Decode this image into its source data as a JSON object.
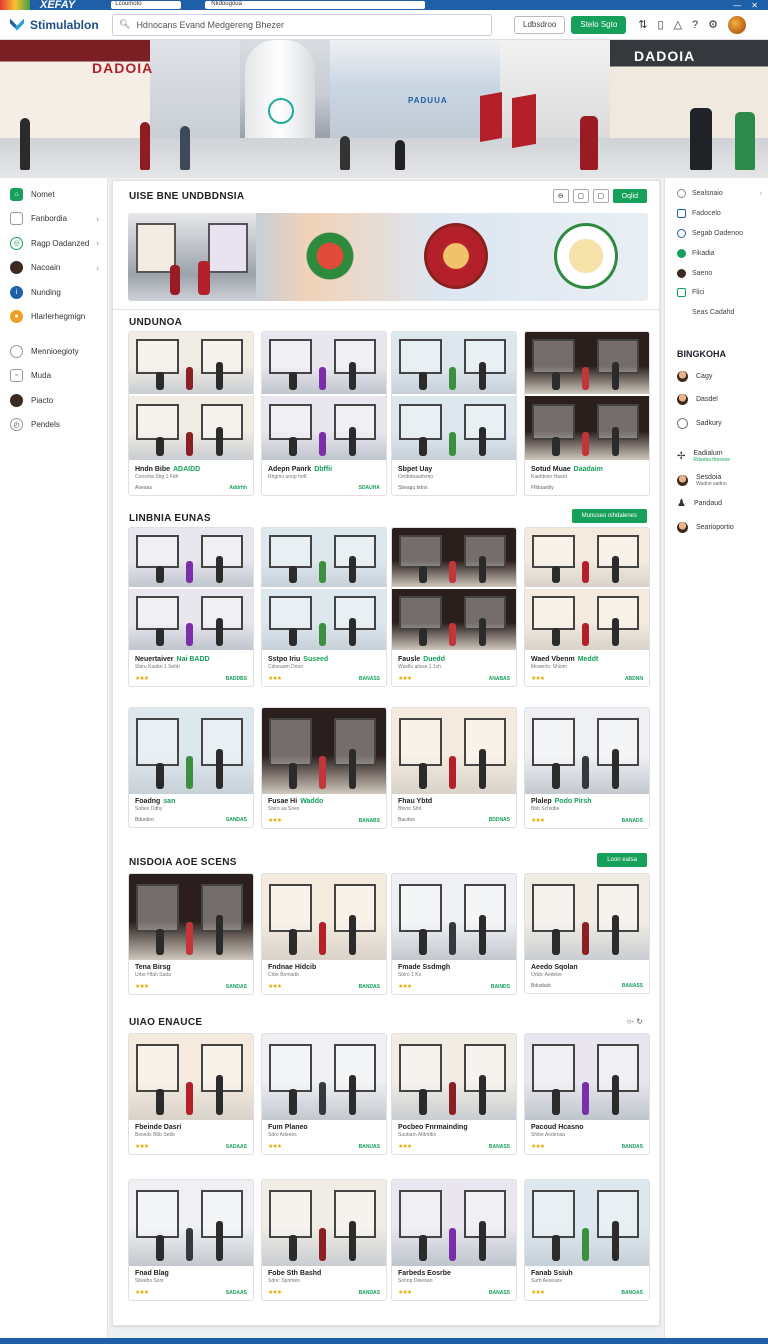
{
  "browser": {
    "brand": "XEFAY",
    "tab": "Lcoumoto",
    "url": "Nkdougoua"
  },
  "header": {
    "logo": "Stimulablon",
    "search_placeholder": "Hdnocans Evand Medgereng Bhezer",
    "btn_outline": "Ldbsdroo",
    "btn_primary": "Stelo Sgto"
  },
  "hero": {
    "signs": [
      "DADOIA",
      "PADUUA",
      "DADOIA"
    ]
  },
  "sidebar": {
    "items": [
      {
        "label": "Nomet",
        "icon": "home-icon",
        "chev": false
      },
      {
        "label": "Fanbordia",
        "icon": "square-icon",
        "chev": true
      },
      {
        "label": "Ragp Oadanzed",
        "icon": "globe-icon",
        "chev": true
      },
      {
        "label": "Nacoain",
        "icon": "user-icon",
        "chev": true
      },
      {
        "label": "Nunding",
        "icon": "info-icon",
        "chev": false
      },
      {
        "label": "Hlarlerhegmign",
        "icon": "bell-icon",
        "chev": false
      }
    ],
    "items2": [
      {
        "label": "Mennioegioty",
        "icon": "chat-icon"
      },
      {
        "label": "Muda",
        "icon": "file-icon"
      },
      {
        "label": "Piacto",
        "icon": "user-icon"
      },
      {
        "label": "Pendels",
        "icon": "clock-icon"
      }
    ]
  },
  "rightbar": {
    "items": [
      "Sealsnaio",
      "Fadocelo",
      "Segab Oadenoo",
      "Fikadia",
      "Saeno",
      "Flici",
      "Seas Cadahd"
    ],
    "heading": "BINGKOHA",
    "people": [
      {
        "name": "Cagy",
        "sub": ""
      },
      {
        "name": "Dasdel",
        "sub": ""
      },
      {
        "name": "Sadkury",
        "sub": ""
      },
      {
        "name": "Eadialum",
        "sub": "Rdanba thesnoe"
      },
      {
        "name": "Sesdoia",
        "sub": "Wadne sadno"
      },
      {
        "name": "Pandaud",
        "sub": ""
      },
      {
        "name": "Searioportio",
        "sub": ""
      }
    ]
  },
  "main": {
    "top_title": "UISE BNE UNDBDNSIA",
    "top_ctrls": [
      "⊖",
      "▢",
      "▢",
      "Oqlid"
    ],
    "sections": [
      {
        "title": "UNDUNOA",
        "button": ""
      },
      {
        "title": "LINBNIA EUNAS",
        "button": "Munuseo nihdalenes"
      },
      {
        "title": "NISDOIA AOE SCENS",
        "button": "Loon eatsa"
      },
      {
        "title": "UIAO ENAUCE",
        "button": ""
      }
    ],
    "rows": [
      [
        {
          "title": "Hndn Bibe",
          "hl": "ADAIDD",
          "sub": "Coosrha Sbg 1 Fdh",
          "stars": "",
          "price": "Addrhh",
          "left": "Aoeaas"
        },
        {
          "title": "Adepn Panrk",
          "hl": "Dbffii",
          "sub": "Rhgmo unop hrdf",
          "stars": "",
          "price": "SDAUHA",
          "left": ""
        },
        {
          "title": "Sbpet Uay",
          "hl": "",
          "sub": "Ovidtdeaadvmo",
          "stars": "",
          "price": "",
          "left": "Sbeagu bdns"
        },
        {
          "title": "Sotud Muae",
          "hl": "Daadaim",
          "sub": "Kaebboin Haarit",
          "stars": "",
          "price": "",
          "left": "Ffldoavbly"
        }
      ],
      [
        {
          "title": "Neuertaiver",
          "hl": "Nai BADD",
          "sub": "Sbiru Kaabo 1 Sebb",
          "stars": "★★★",
          "price": "BADDBS",
          "left": ""
        },
        {
          "title": "Sstpo Iriu",
          "hl": "Suseed",
          "sub": "Cdneaam Dooo",
          "stars": "★★★",
          "price": "BANASS",
          "left": ""
        },
        {
          "title": "Fausle",
          "hl": "Duedd",
          "sub": "Wuidlu alisse 1 1zh",
          "stars": "★★★",
          "price": "ANABAS",
          "left": ""
        },
        {
          "title": "Waed Vbenm",
          "hl": "Meddt",
          "sub": "Mowerlo: Shiom",
          "stars": "★★★",
          "price": "ABDNN",
          "left": ""
        }
      ],
      [
        {
          "title": "Foadng",
          "hl": "san",
          "sub": "Sobeo Ddhy",
          "stars": "",
          "price": "SANDAS",
          "left": "Bdunbro"
        },
        {
          "title": "Fusae Hi",
          "hl": "Waddo",
          "sub": "Sbiro aa Snes",
          "stars": "★★★",
          "price": "BANABS",
          "left": ""
        },
        {
          "title": "Fhau Ybtd",
          "hl": "",
          "sub": "Bbvro Shd",
          "stars": "",
          "price": "BDDNAS",
          "left": "Bacdoo"
        },
        {
          "title": "Plalep",
          "hl": "Podo Pirsh",
          "sub": "Bbb Schidbe",
          "stars": "★★★",
          "price": "BANADS",
          "left": ""
        }
      ],
      [
        {
          "title": "Tena Birsg",
          "hl": "",
          "sub": "Urbe Hfah Sada",
          "stars": "★★★",
          "price": "SANDAS",
          "left": ""
        },
        {
          "title": "Fndnae Hidcib",
          "hl": "",
          "sub": "Crbe Bnmadb",
          "stars": "★★★",
          "price": "BANDAS",
          "left": ""
        },
        {
          "title": "Fmade Ssdmgh",
          "hl": "",
          "sub": "Sbiro 1 Ks",
          "stars": "★★★",
          "price": "BAINDS",
          "left": ""
        },
        {
          "title": "Aeedo Sqolan",
          "hl": "",
          "sub": "Orbb: Aedebe",
          "stars": "",
          "price": "BANASS",
          "left": "Bdusbab"
        }
      ],
      [
        {
          "title": "Fbeinde Dasri",
          "hl": "",
          "sub": "Bsoeds Bbb Sebb",
          "stars": "★★★",
          "price": "SADAAS",
          "left": ""
        },
        {
          "title": "Fum Planeo",
          "hl": "",
          "sub": "Sdro Adeees",
          "stars": "★★★",
          "price": "BANUAS",
          "left": ""
        },
        {
          "title": "Pocbeo Fnrmainding",
          "hl": "",
          "sub": "Suobam Afdndbs",
          "stars": "★★★",
          "price": "BANASS",
          "left": ""
        },
        {
          "title": "Pacoud Hcasno",
          "hl": "",
          "sub": "Shibe Aodenaa",
          "stars": "★★★",
          "price": "BANDAS",
          "left": ""
        }
      ],
      [
        {
          "title": "Fnad Blag",
          "hl": "",
          "sub": "Sbeebs Sonr",
          "stars": "★★★",
          "price": "SADAAS",
          "left": ""
        },
        {
          "title": "Fobe Sth Bashd",
          "hl": "",
          "sub": "Sdre: Spnmeo",
          "stars": "★★★",
          "price": "BANDAS",
          "left": ""
        },
        {
          "title": "Farbeds Eosrbe",
          "hl": "",
          "sub": "Sohnp Dieeoan",
          "stars": "★★★",
          "price": "BANASS",
          "left": ""
        },
        {
          "title": "Fanab Ssiuh",
          "hl": "",
          "sub": "Surb Aeseass",
          "stars": "★★★",
          "price": "BANOAS",
          "left": ""
        }
      ]
    ],
    "banner_photo_sign": "PADCUA"
  },
  "colors": {
    "accent": "#16a05a",
    "brand": "#1f5fa8"
  }
}
